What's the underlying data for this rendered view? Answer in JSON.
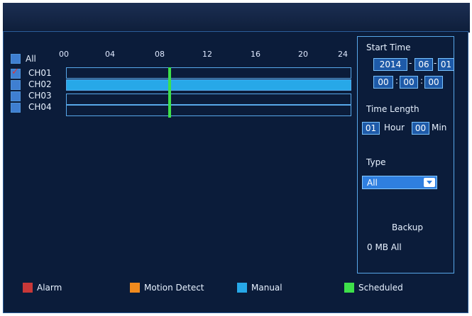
{
  "channels": {
    "all_label": "All",
    "items": [
      {
        "label": "CH01",
        "checked": true
      },
      {
        "label": "CH02",
        "checked": false
      },
      {
        "label": "CH03",
        "checked": false
      },
      {
        "label": "CH04",
        "checked": false
      }
    ]
  },
  "timeline": {
    "hour_labels": [
      "00",
      "04",
      "08",
      "12",
      "16",
      "20",
      "24"
    ],
    "marker_hour": 8.6
  },
  "start_time": {
    "label": "Start Time",
    "year": "2014",
    "month": "06",
    "day": "01",
    "hour": "00",
    "minute": "00",
    "second": "00"
  },
  "time_length": {
    "label": "Time Length",
    "hours": "01",
    "hour_unit": "Hour",
    "minutes": "00",
    "minute_unit": "Min"
  },
  "type": {
    "label": "Type",
    "selected": "All"
  },
  "backup": {
    "label": "Backup",
    "size_text": "0 MB All"
  },
  "legend": {
    "items": [
      {
        "label": "Alarm",
        "color": "#c83838"
      },
      {
        "label": "Motion Detect",
        "color": "#f08a1e"
      },
      {
        "label": "Manual",
        "color": "#27a8e8"
      },
      {
        "label": "Scheduled",
        "color": "#3ee04a"
      }
    ]
  }
}
